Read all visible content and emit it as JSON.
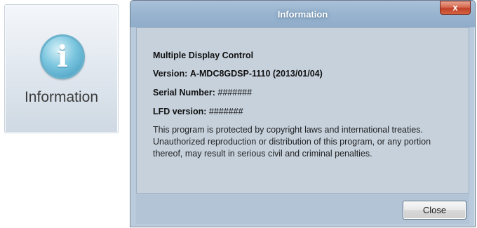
{
  "tile": {
    "icon": "info-icon",
    "icon_glyph": "i",
    "label": "Information"
  },
  "dialog": {
    "title": "Information",
    "close_glyph": "x",
    "product": "Multiple Display Control",
    "version_label": "Version:",
    "version_value": "A-MDC8GDSP-1110 (2013/01/04)",
    "serial_label": "Serial Number:",
    "serial_value": "#######",
    "lfd_label": "LFD version:",
    "lfd_value": "#######",
    "notice_line1": "This program is protected by copyright laws and international treaties.",
    "notice_line2": "Unauthorized reproduction or distribution of this program, or any portion",
    "notice_line3": "thereof, may result in serious civil and criminal penalties.",
    "close_button": "Close"
  }
}
